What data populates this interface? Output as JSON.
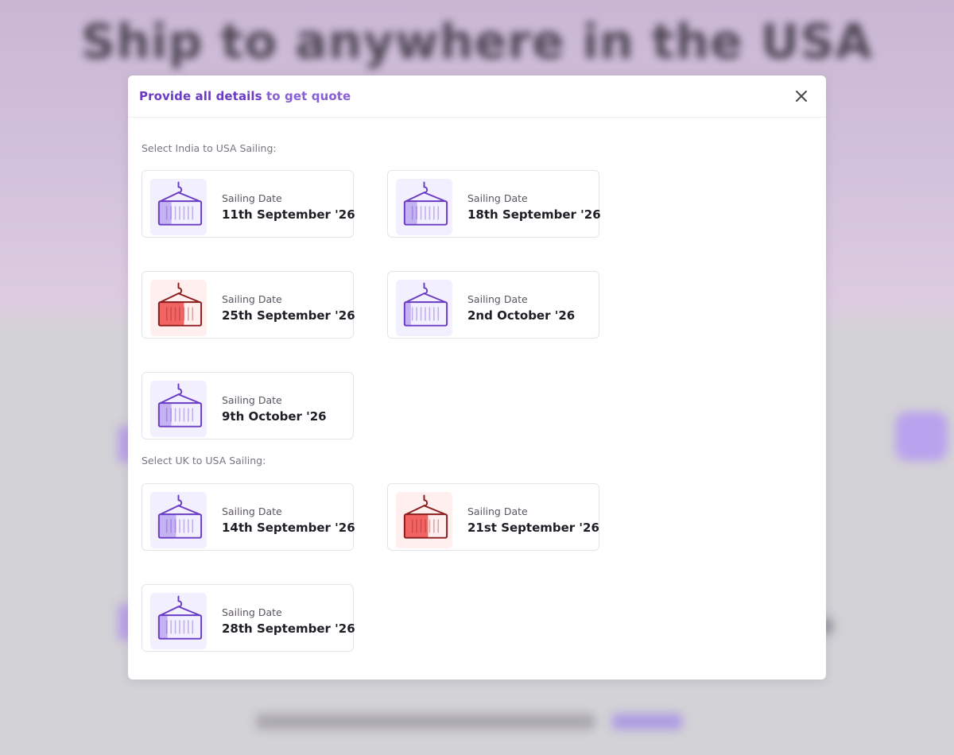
{
  "background": {
    "hero_title": "Ship to anywhere in the USA"
  },
  "modal": {
    "title_part1": "Provide all details",
    "title_part2": " to get quote",
    "close_icon": "close-icon"
  },
  "sections": [
    {
      "label": "Select India to USA Sailing:",
      "cards": [
        {
          "caption": "Sailing Date",
          "date": "11th September '26",
          "status": "available",
          "fill": 0.3
        },
        {
          "caption": "Sailing Date",
          "date": "18th September '26",
          "status": "available",
          "fill": 0.3
        },
        {
          "caption": "Sailing Date",
          "date": "25th September '26",
          "status": "almost-full",
          "fill": 0.6
        },
        {
          "caption": "Sailing Date",
          "date": "2nd October '26",
          "status": "available",
          "fill": 0.15
        },
        {
          "caption": "Sailing Date",
          "date": "9th October '26",
          "status": "available",
          "fill": 0.3
        }
      ]
    },
    {
      "label": "Select UK to USA Sailing:",
      "cards": [
        {
          "caption": "Sailing Date",
          "date": "14th September '26",
          "status": "available",
          "fill": 0.4
        },
        {
          "caption": "Sailing Date",
          "date": "21st September '26",
          "status": "almost-full",
          "fill": 0.55
        },
        {
          "caption": "Sailing Date",
          "date": "28th September '26",
          "status": "available",
          "fill": 0.2
        }
      ]
    }
  ],
  "colors": {
    "accent": "#6a3cc4",
    "available_stroke": "#6a3cc4",
    "available_fill": "#c4b2f3",
    "available_tile": "#f2efff",
    "full_stroke": "#8b1d1d",
    "full_fill": "#f26464",
    "full_tile": "#fff0ef"
  },
  "icons": {
    "container": "shipping-container-icon"
  }
}
